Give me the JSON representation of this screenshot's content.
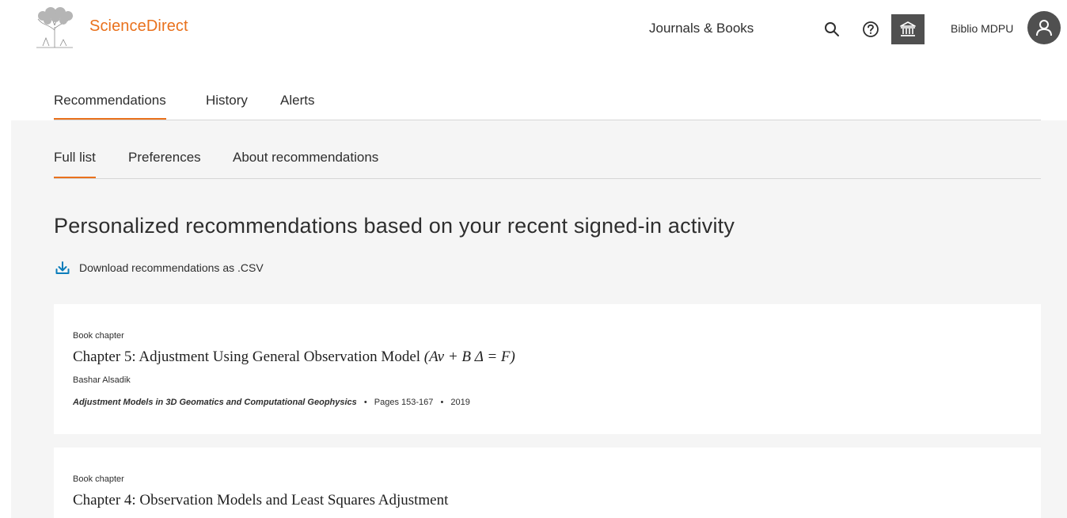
{
  "header": {
    "brand": "ScienceDirect",
    "nav_journals": "Journals & Books",
    "user_name": "Biblio MDPU",
    "icons": {
      "search": "search-icon",
      "help": "help-icon",
      "institution": "institution-icon",
      "avatar": "user-avatar-icon"
    }
  },
  "tabs_primary": [
    {
      "label": "Recommendations",
      "active": true
    },
    {
      "label": "History",
      "active": false
    },
    {
      "label": "Alerts",
      "active": false
    }
  ],
  "tabs_secondary": [
    {
      "label": "Full list",
      "active": true
    },
    {
      "label": "Preferences",
      "active": false
    },
    {
      "label": "About recommendations",
      "active": false
    }
  ],
  "page_title": "Personalized recommendations based on your recent signed-in activity",
  "download_label": "Download recommendations as .CSV",
  "results": [
    {
      "type": "Book chapter",
      "title_text": "Chapter 5: Adjustment Using General Observation Model",
      "title_math": "(Av + B Δ = F)",
      "author": "Bashar Alsadik",
      "source": "Adjustment Models in 3D Geomatics and Computational Geophysics",
      "pages": "Pages 153-167",
      "year": "2019"
    },
    {
      "type": "Book chapter",
      "title_text": "Chapter 4: Observation Models and Least Squares Adjustment"
    }
  ],
  "colors": {
    "accent": "#e9711c",
    "panel_bg": "#f5f5f5",
    "icon_dark": "#505050"
  }
}
